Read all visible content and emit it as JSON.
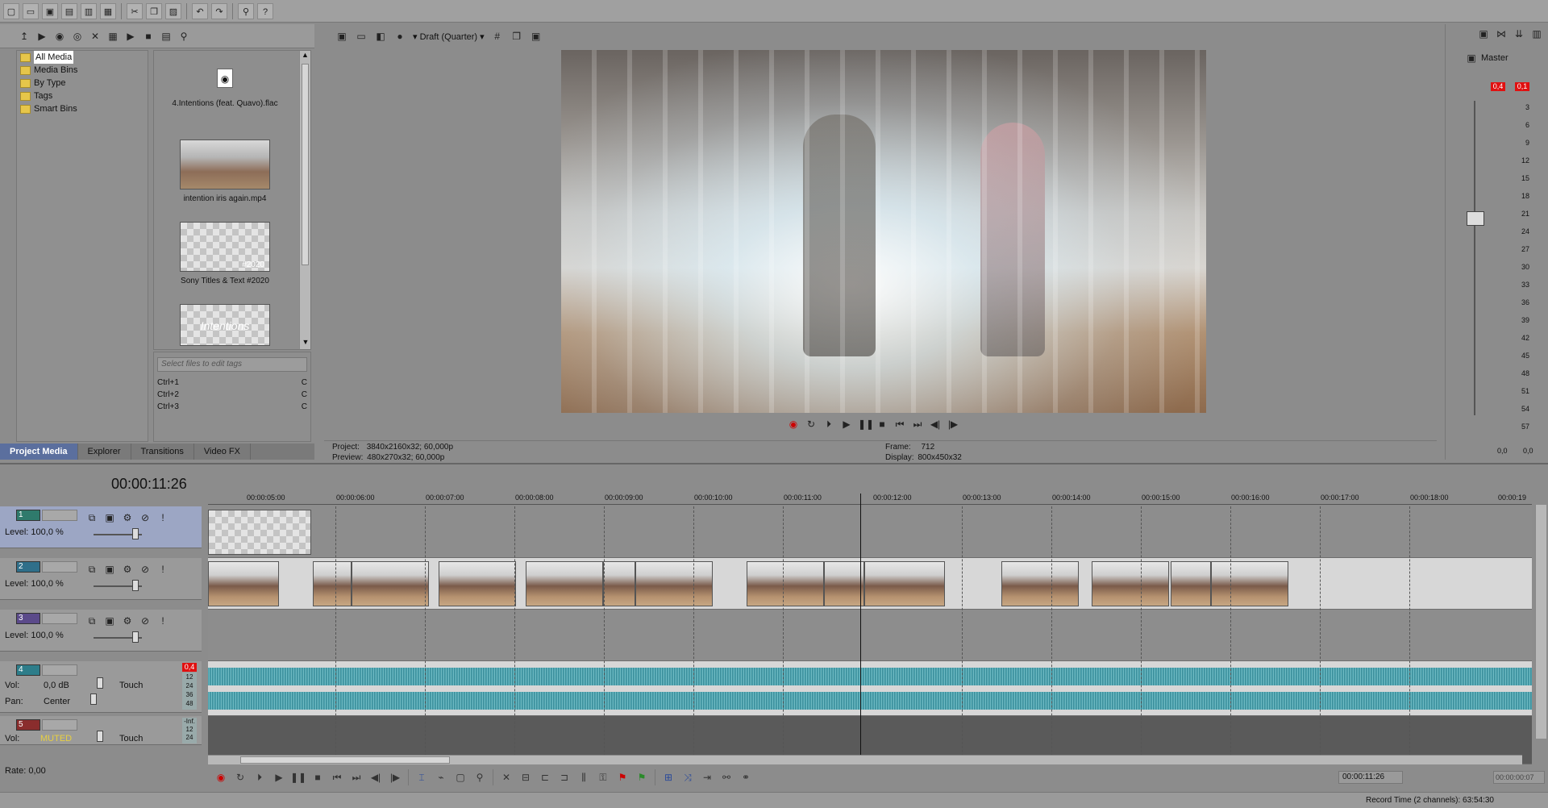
{
  "toolbar": {
    "icons": [
      "new-icon",
      "open-icon",
      "save-icon",
      "save-as-icon",
      "render-icon",
      "properties-icon",
      "cut-icon",
      "copy-icon",
      "paste-icon",
      "undo-icon",
      "redo-icon",
      "enable-snapping-icon",
      "whats-this-icon"
    ]
  },
  "media_panel": {
    "tree": [
      "All Media",
      "Media Bins",
      "By Type",
      "Tags",
      "Smart Bins"
    ],
    "items": [
      {
        "label": "4.Intentions (feat. Quavo).flac",
        "kind": "audio"
      },
      {
        "label": "intention iris again.mp4",
        "kind": "video"
      },
      {
        "label": "Sony Titles & Text #2020",
        "kind": "title",
        "overlay": "#2020"
      },
      {
        "label": "",
        "kind": "title",
        "overlay": "Intentions"
      }
    ],
    "tag_placeholder": "Select files to edit tags",
    "shortcuts": [
      "Ctrl+1",
      "Ctrl+2",
      "Ctrl+3"
    ],
    "shortcut_values": [
      "C",
      "C",
      "C"
    ]
  },
  "tabs": [
    "Project Media",
    "Explorer",
    "Transitions",
    "Video FX"
  ],
  "preview": {
    "quality": "Draft (Quarter)",
    "project_label": "Project:",
    "project_value": "3840x2160x32; 60,000p",
    "preview_label": "Preview:",
    "preview_value": "480x270x32; 60,000p",
    "frame_label": "Frame:",
    "frame_value": "712",
    "display_label": "Display:",
    "display_value": "800x450x32"
  },
  "master": {
    "title": "Master",
    "peak_left": "0,4",
    "peak_right": "0,1",
    "scale": [
      "3",
      "6",
      "9",
      "12",
      "15",
      "18",
      "21",
      "24",
      "27",
      "30",
      "33",
      "36",
      "39",
      "42",
      "45",
      "48",
      "51",
      "54",
      "57"
    ],
    "bottom_left": "0,0",
    "bottom_right": "0,0"
  },
  "timeline": {
    "timecode": "00:00:11:26",
    "ruler": [
      "00:00:05:00",
      "00:00:06:00",
      "00:00:07:00",
      "00:00:08:00",
      "00:00:09:00",
      "00:00:10:00",
      "00:00:11:00",
      "00:00:12:00",
      "00:00:13:00",
      "00:00:14:00",
      "00:00:15:00",
      "00:00:16:00",
      "00:00:17:00",
      "00:00:18:00",
      "00:00:19"
    ],
    "tracks": [
      {
        "num": "1",
        "level": "Level: 100,0 %",
        "type": "video"
      },
      {
        "num": "2",
        "level": "Level: 100,0 %",
        "type": "video"
      },
      {
        "num": "3",
        "level": "Level: 100,0 %",
        "type": "video"
      }
    ],
    "audio_tracks": [
      {
        "num": "4",
        "vol_label": "Vol:",
        "vol": "0,0 dB",
        "pan_label": "Pan:",
        "pan": "Center",
        "mode": "Touch",
        "peak": "0,4",
        "meter": [
          "12",
          "24",
          "36",
          "48"
        ]
      },
      {
        "num": "5",
        "vol_label": "Vol:",
        "vol": "MUTED",
        "mode": "Touch",
        "peak": "-Inf.",
        "meter": [
          "12",
          "24"
        ]
      }
    ],
    "rate": "Rate: 0,00"
  },
  "status": {
    "cursor_time": "00:00:11:26",
    "selection_time": "00:00:00:07",
    "record_time": "Record Time (2 channels): 63:54:30"
  },
  "colors": {
    "accent": "#5b6f9e",
    "audio_wave": "#3a9aa8",
    "peak_red": "#e01010"
  }
}
